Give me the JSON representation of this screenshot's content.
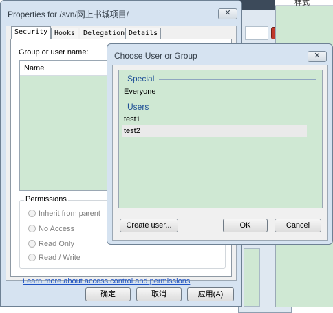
{
  "background": {
    "right_panel_label": "样式"
  },
  "properties_window": {
    "title": "Properties for /svn/网上书城项目/",
    "close_label": "✕",
    "tabs": [
      {
        "label": "Security",
        "active": true
      },
      {
        "label": "Hooks",
        "active": false
      },
      {
        "label": "Delegation",
        "active": false
      },
      {
        "label": "Details",
        "active": false
      }
    ],
    "group_label": "Group or user name:",
    "list_header": "Name",
    "permissions": {
      "legend": "Permissions",
      "options": [
        "Inherit from parent",
        "No Access",
        "Read Only",
        "Read / Write"
      ]
    },
    "learn_more_link": "Learn more about access control and permissions",
    "buttons": {
      "ok": "确定",
      "cancel": "取消",
      "apply": "应用(A)"
    }
  },
  "choose_dialog": {
    "title": "Choose User or Group",
    "close_label": "✕",
    "sections": [
      {
        "label": "Special",
        "items": [
          "Everyone"
        ]
      },
      {
        "label": "Users",
        "items": [
          "test1",
          "test2"
        ]
      }
    ],
    "highlighted_item": "test2",
    "buttons": {
      "create_user": "Create user...",
      "ok": "OK",
      "cancel": "Cancel"
    }
  },
  "colors": {
    "list_background": "#cfe8d3",
    "window_frame": "#d6e3f1",
    "section_header": "#1e4f96",
    "link": "#1f53c3"
  }
}
